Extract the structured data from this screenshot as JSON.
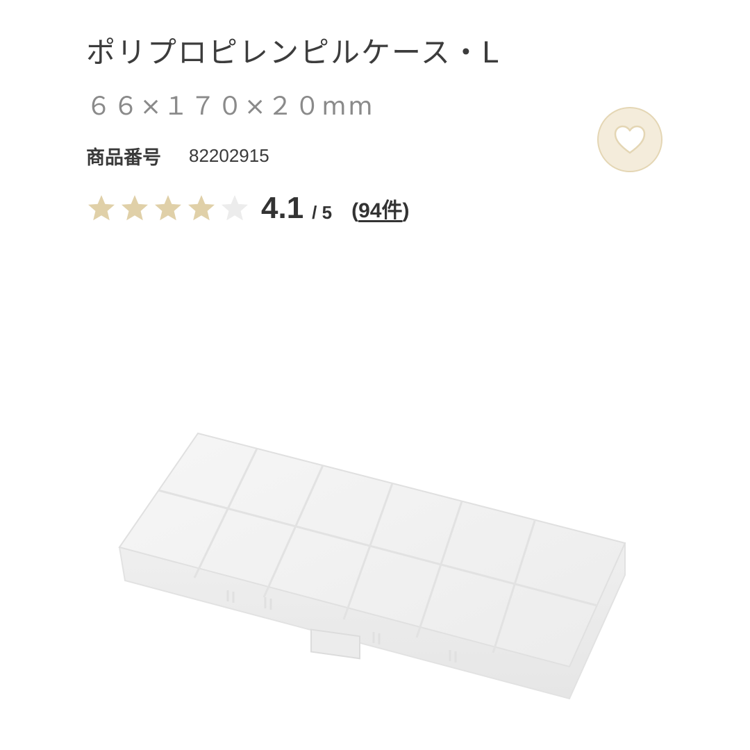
{
  "product": {
    "title": "ポリプロピレンピルケース・L",
    "size": "６６×１７０×２０mm",
    "code_label": "商品番号",
    "code_value": "82202915"
  },
  "favorite": {
    "icon": "heart-icon",
    "color": "#f4ecdb",
    "icon_color": "#ffffff"
  },
  "rating": {
    "value": "4.1",
    "max": "/ 5",
    "stars_filled": 4,
    "stars_total": 5,
    "review_open": "(",
    "review_count": "94件",
    "review_close": ")",
    "star_color": "#e0d0a8",
    "star_empty_color": "#ececec"
  },
  "image": {
    "subject": "pill-case-image"
  }
}
